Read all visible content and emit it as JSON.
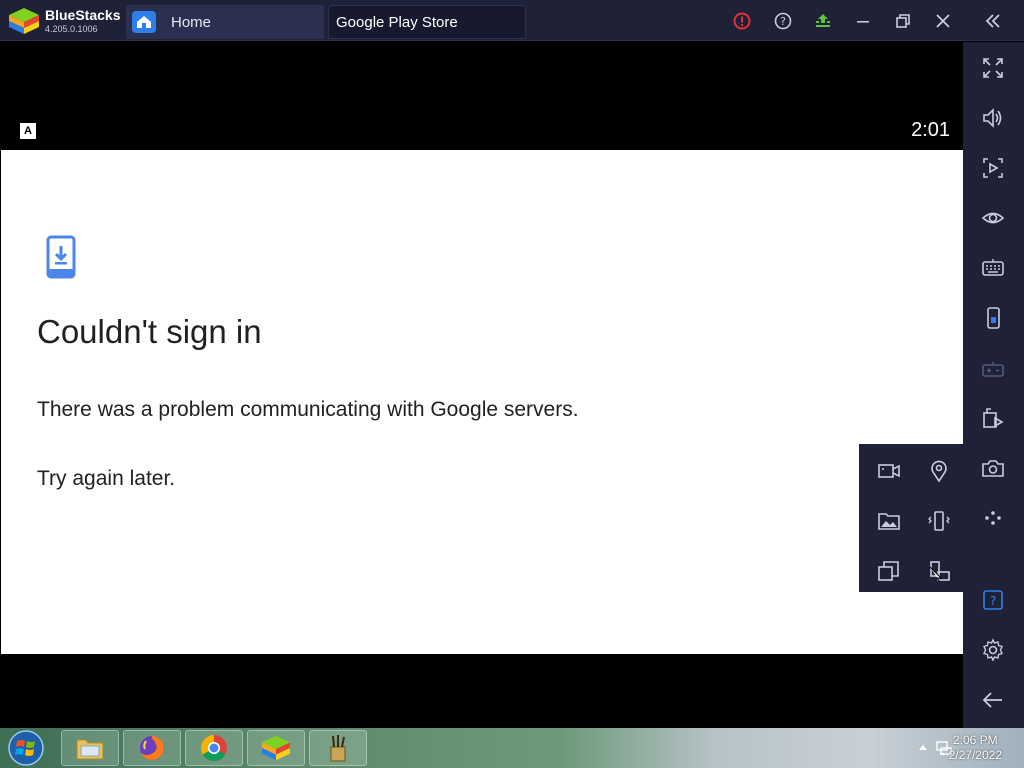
{
  "app": {
    "name": "BlueStacks",
    "version": "4.205.0.1006"
  },
  "tabs": [
    {
      "label": "Home"
    },
    {
      "label": "Google Play Store"
    }
  ],
  "android": {
    "status_badge": "A",
    "clock": "2:01"
  },
  "dialog": {
    "title": "Couldn't sign in",
    "message": "There was a problem communicating with Google servers.",
    "retry_note": "Try again later."
  },
  "taskbar": {
    "time": "2:06 PM",
    "date": "2/27/2022"
  },
  "colors": {
    "accent_blue": "#4a86e8",
    "titlebar_bg": "#1f2136",
    "alert_red": "#e0323a",
    "update_green": "#5ec43b"
  }
}
